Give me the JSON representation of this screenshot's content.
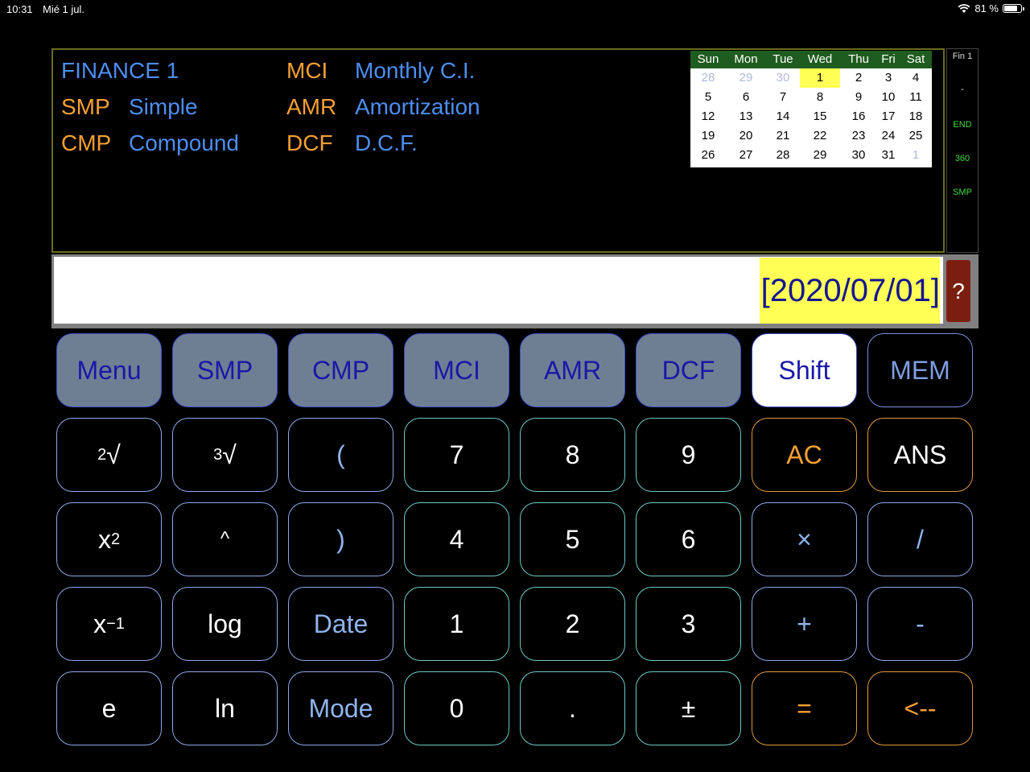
{
  "status_bar": {
    "time": "10:31",
    "date": "Mié 1 jul.",
    "battery": "81 %",
    "battery_level": 0.81
  },
  "display": {
    "menu": [
      {
        "code": "FINANCE 1",
        "label": ""
      },
      {
        "code": "SMP",
        "label": "Simple"
      },
      {
        "code": "CMP",
        "label": "Compound"
      },
      {
        "code": "MCI",
        "label": "Monthly C.I."
      },
      {
        "code": "AMR",
        "label": "Amortization"
      },
      {
        "code": "DCF",
        "label": "D.C.F."
      }
    ]
  },
  "calendar": {
    "days": [
      "Sun",
      "Mon",
      "Tue",
      "Wed",
      "Thu",
      "Fri",
      "Sat"
    ],
    "weeks": [
      [
        "28",
        "29",
        "30",
        "1",
        "2",
        "3",
        "4"
      ],
      [
        "5",
        "6",
        "7",
        "8",
        "9",
        "10",
        "11"
      ],
      [
        "12",
        "13",
        "14",
        "15",
        "16",
        "17",
        "18"
      ],
      [
        "19",
        "20",
        "21",
        "22",
        "23",
        "24",
        "25"
      ],
      [
        "26",
        "27",
        "28",
        "29",
        "30",
        "31",
        "1"
      ]
    ]
  },
  "side_panel": {
    "title": "Fin 1",
    "dash": "-",
    "mode1": "END",
    "mode2": "360",
    "mode3": "SMP"
  },
  "entry": {
    "value": "[2020/07/01]",
    "help_label": "?"
  },
  "keys": {
    "menu": "Menu",
    "smp": "SMP",
    "cmp": "CMP",
    "mci": "MCI",
    "amr": "AMR",
    "dcf": "DCF",
    "shift": "Shift",
    "mem": "MEM",
    "sqrt2_sup": "2",
    "sqrt3_sup": "3",
    "root_sign": "√",
    "open_paren": "(",
    "seven": "7",
    "eight": "8",
    "nine": "9",
    "ac": "AC",
    "ans": "ANS",
    "x_base": "x",
    "square_sup": "2",
    "power": "^",
    "close_paren": ")",
    "four": "4",
    "five": "5",
    "six": "6",
    "multiply": "×",
    "divide": "/",
    "inverse_sup": "−1",
    "log": "log",
    "date": "Date",
    "one": "1",
    "two": "2",
    "three": "3",
    "plus": "+",
    "minus": "-",
    "e": "e",
    "ln": "ln",
    "mode": "Mode",
    "zero": "0",
    "dot": ".",
    "plus_minus": "±",
    "equals": "=",
    "backspace": "<--"
  },
  "colors": {
    "accent_orange": "#f5a033",
    "accent_blue": "#4d8ef0",
    "today_highlight": "#ffff55",
    "help_red": "#7a1f10"
  }
}
